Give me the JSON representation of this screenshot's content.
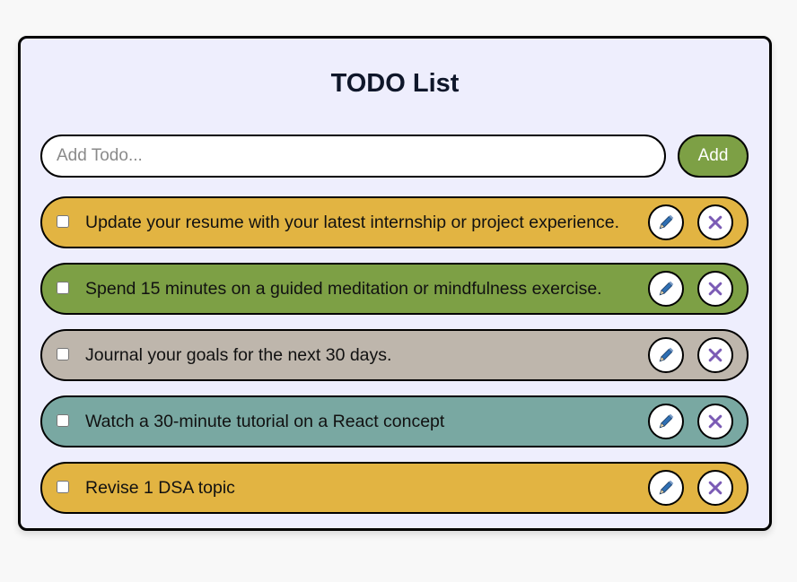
{
  "header": {
    "title": "TODO List"
  },
  "form": {
    "input_placeholder": "Add Todo...",
    "input_value": "",
    "add_label": "Add"
  },
  "colors": {
    "card_bg": "#eeeefd",
    "add_button": "#7da045",
    "edit_icon": "#2f6fb3",
    "delete_icon": "#7b5bb5"
  },
  "todos": [
    {
      "text": "Update your resume with your latest internship or project experience.",
      "color": "#e2b442",
      "completed": false,
      "edit_icon": "pencil-icon",
      "delete_icon": "close-icon"
    },
    {
      "text": "Spend 15 minutes on a guided meditation or mindfulness exercise.",
      "color": "#7da045",
      "completed": false,
      "edit_icon": "pencil-icon",
      "delete_icon": "close-icon"
    },
    {
      "text": "Journal your goals for the next 30 days.",
      "color": "#beb6ac",
      "completed": false,
      "edit_icon": "pencil-icon",
      "delete_icon": "close-icon"
    },
    {
      "text": "Watch a 30-minute tutorial on a React concept",
      "color": "#79a8a2",
      "completed": false,
      "edit_icon": "pencil-icon",
      "delete_icon": "close-icon"
    },
    {
      "text": "Revise 1 DSA topic",
      "color": "#e2b442",
      "completed": false,
      "edit_icon": "pencil-icon",
      "delete_icon": "close-icon"
    }
  ]
}
